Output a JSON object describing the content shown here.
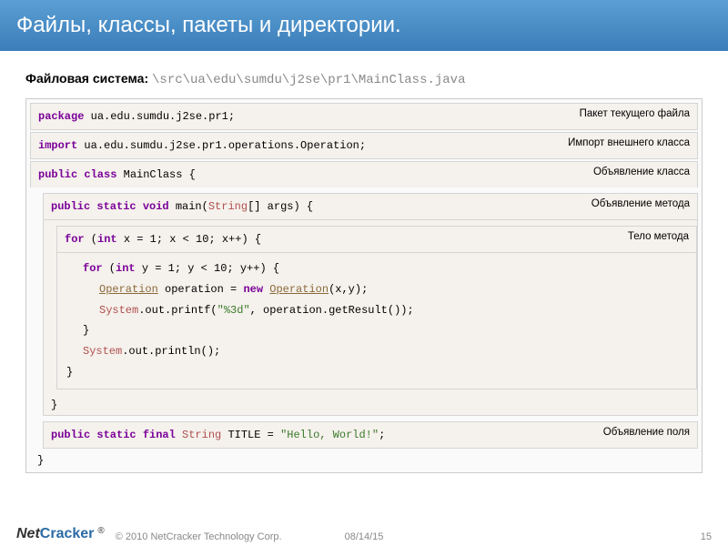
{
  "header": {
    "title": "Файлы, классы, пакеты и директории."
  },
  "fs": {
    "label": "Файловая система: ",
    "path": "\\src\\ua\\edu\\sumdu\\j2se\\pr1\\MainClass.java"
  },
  "labels": {
    "package": "Пакет текущего файла",
    "import": "Импорт внешнего класса",
    "class": "Объявление класса",
    "method": "Объявление метода",
    "body": "Тело метода",
    "field": "Объявление поля"
  },
  "code": {
    "pkg_kw": "package",
    "pkg_path": " ua.edu.sumdu.j2se.pr1;",
    "imp_kw": "import",
    "imp_path": " ua.edu.sumdu.j2se.pr1.operations.Operation;",
    "cls_mod": "public class",
    "cls_name": " MainClass {",
    "m_mod": "public static void",
    "m_sig_a": " main(",
    "m_type": "String",
    "m_sig_b": "[] args) {",
    "for1_a": "for",
    "for1_b": " (",
    "for1_c": "int",
    "for1_d": " x = 1; x < 10; x++) {",
    "for2_a": "for",
    "for2_b": " (",
    "for2_c": "int",
    "for2_d": " y = 1; y < 10; y++) {",
    "op_a": "Operation",
    "op_b": " operation = ",
    "op_c": "new",
    "op_d": " ",
    "op_e": "Operation",
    "op_f": "(x,y);",
    "pf_a": "System",
    "pf_b": ".out.printf(",
    "pf_c": "\"%3d\"",
    "pf_d": ", operation.getResult());",
    "brace": "}",
    "pl_a": "System",
    "pl_b": ".out.println();",
    "fld_mod": "public static final ",
    "fld_type": "String",
    "fld_name": " TITLE = ",
    "fld_val": "\"Hello, World!\"",
    "fld_end": ";"
  },
  "footer": {
    "logo_a": "Net",
    "logo_b": "Cracker",
    "reg": "®",
    "copyright": "© 2010 NetCracker Technology Corp.",
    "date": "08/14/15",
    "page": "15"
  }
}
